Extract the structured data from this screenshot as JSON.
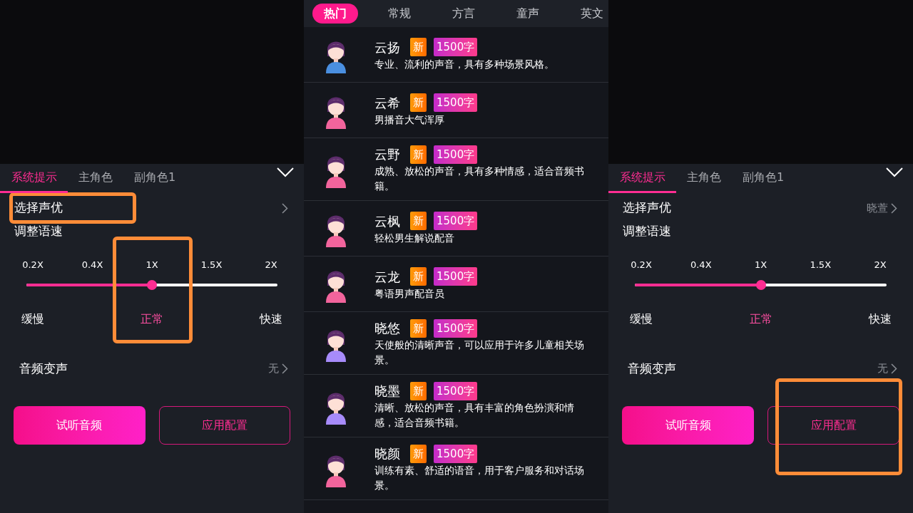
{
  "panels": [
    {
      "tabs": [
        {
          "label": "系统提示",
          "selected": true
        },
        {
          "label": "主角色",
          "selected": false
        },
        {
          "label": "副角色1",
          "selected": false
        }
      ],
      "voice_row": {
        "label": "选择声优",
        "highlighted": true
      },
      "speed": {
        "label": "调整语速",
        "ticks": [
          "0.2X",
          "0.4X",
          "1X",
          "1.5X",
          "2X"
        ],
        "level": 0.5,
        "highlighted": true,
        "captions": [
          {
            "label": "缓慢",
            "selected": false
          },
          {
            "label": "正常",
            "selected": true
          },
          {
            "label": "快速",
            "selected": false
          }
        ]
      },
      "effect_row": {
        "label": "音频变声",
        "value": "无"
      },
      "buttons": [
        {
          "label": "试听音频",
          "kind": "primary",
          "highlighted": false
        },
        {
          "label": "应用配置",
          "kind": "outline",
          "highlighted": false
        }
      ]
    },
    {
      "tabs": [
        {
          "label": "系统提示",
          "selected": true
        },
        {
          "label": "主角色",
          "selected": false
        },
        {
          "label": "副角色1",
          "selected": false
        }
      ],
      "voice_row": {
        "label": "选择声优",
        "value": "晓萱",
        "highlighted": false
      },
      "speed": {
        "label": "调整语速",
        "ticks": [
          "0.2X",
          "0.4X",
          "1X",
          "1.5X",
          "2X"
        ],
        "level": 0.5,
        "highlighted": false,
        "captions": [
          {
            "label": "缓慢",
            "selected": false
          },
          {
            "label": "正常",
            "selected": true
          },
          {
            "label": "快速",
            "selected": false
          }
        ]
      },
      "effect_row": {
        "label": "音频变声",
        "value": "无"
      },
      "buttons": [
        {
          "label": "试听音频",
          "kind": "primary",
          "highlighted": false
        },
        {
          "label": "应用配置",
          "kind": "outline",
          "highlighted": true
        }
      ]
    }
  ],
  "voice_list": {
    "categories": [
      {
        "label": "热门",
        "selected": true
      },
      {
        "label": "常规",
        "selected": false
      },
      {
        "label": "方言",
        "selected": false
      },
      {
        "label": "童声",
        "selected": false
      },
      {
        "label": "英文",
        "selected": false
      }
    ],
    "voices": [
      {
        "name": "云扬",
        "color": "#4a8fe0",
        "tags": [
          {
            "label": "新",
            "kind": "new"
          },
          {
            "label": "1500字",
            "kind": "quota"
          }
        ],
        "description": "专业、流利的声音，具有多种场景风格。"
      },
      {
        "name": "云希",
        "color": "#f2649c",
        "tags": [
          {
            "label": "新",
            "kind": "new"
          },
          {
            "label": "1500字",
            "kind": "quota"
          }
        ],
        "description": "男播音大气浑厚"
      },
      {
        "name": "云野",
        "color": "#f2649c",
        "tags": [
          {
            "label": "新",
            "kind": "new"
          },
          {
            "label": "1500字",
            "kind": "quota"
          }
        ],
        "description": "成熟、放松的声音，具有多种情感，适合音频书籍。"
      },
      {
        "name": "云枫",
        "color": "#f2649c",
        "tags": [
          {
            "label": "新",
            "kind": "new"
          },
          {
            "label": "1500字",
            "kind": "quota"
          }
        ],
        "description": "轻松男生解说配音"
      },
      {
        "name": "云龙",
        "color": "#f2649c",
        "tags": [
          {
            "label": "新",
            "kind": "new"
          },
          {
            "label": "1500字",
            "kind": "quota"
          }
        ],
        "description": "粤语男声配音员"
      },
      {
        "name": "晓悠",
        "color": "#a78bfa",
        "tags": [
          {
            "label": "新",
            "kind": "new"
          },
          {
            "label": "1500字",
            "kind": "quota"
          }
        ],
        "description": "天使般的清晰声音，可以应用于许多儿童相关场景。"
      },
      {
        "name": "晓墨",
        "color": "#a78bfa",
        "tags": [
          {
            "label": "新",
            "kind": "new"
          },
          {
            "label": "1500字",
            "kind": "quota"
          }
        ],
        "description": "清晰、放松的声音，具有丰富的角色扮演和情感，适合音频书籍。"
      },
      {
        "name": "晓颜",
        "color": "#f2649c",
        "tags": [
          {
            "label": "新",
            "kind": "new"
          },
          {
            "label": "1500字",
            "kind": "quota"
          }
        ],
        "description": "训练有素、舒适的语音，用于客户服务和对话场景。"
      }
    ]
  }
}
